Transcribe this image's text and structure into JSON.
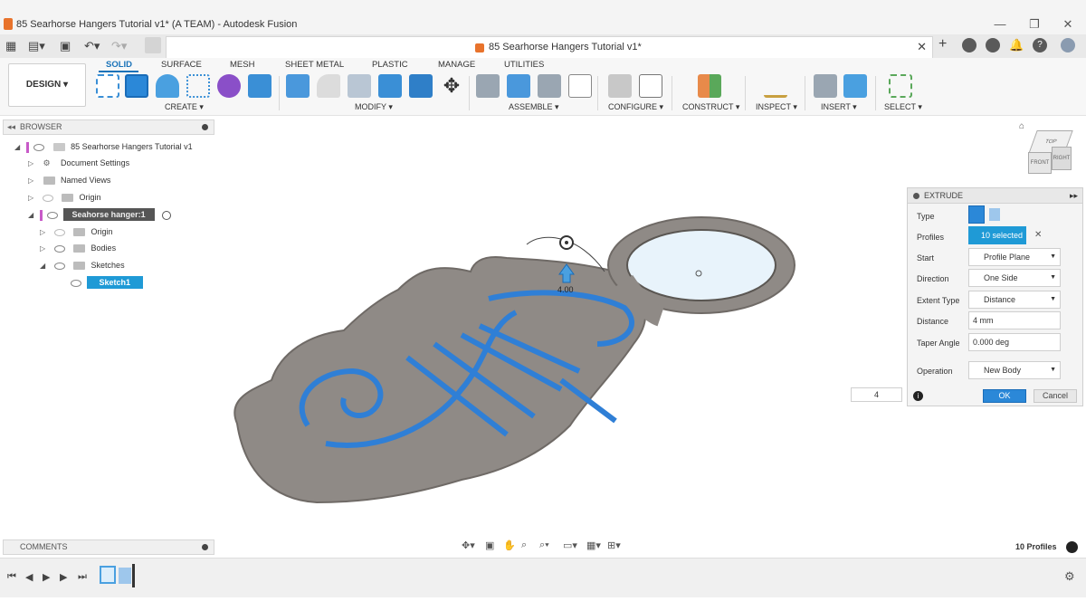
{
  "window": {
    "title": "85 Searhorse Hangers Tutorial v1* (A TEAM) - Autodesk Fusion",
    "minimize": "—",
    "maximize": "❐",
    "close": "✕"
  },
  "document_tab": {
    "title": "85 Searhorse Hangers Tutorial v1*",
    "close": "✕"
  },
  "ribbon": {
    "workspace": "DESIGN ▾",
    "tabs": [
      "SOLID",
      "SURFACE",
      "MESH",
      "SHEET METAL",
      "PLASTIC",
      "MANAGE",
      "UTILITIES"
    ],
    "active_tab": "SOLID",
    "groups": [
      "CREATE ▾",
      "MODIFY ▾",
      "ASSEMBLE ▾",
      "CONFIGURE ▾",
      "CONSTRUCT ▾",
      "INSPECT ▾",
      "INSERT ▾",
      "SELECT ▾"
    ]
  },
  "browser": {
    "title": "BROWSER",
    "items": [
      {
        "label": "85 Searhorse Hangers Tutorial v1"
      },
      {
        "label": "Document Settings"
      },
      {
        "label": "Named Views"
      },
      {
        "label": "Origin"
      },
      {
        "label": "Seahorse hanger:1"
      },
      {
        "label": "Origin"
      },
      {
        "label": "Bodies"
      },
      {
        "label": "Sketches"
      },
      {
        "label": "Sketch1"
      }
    ]
  },
  "comments": {
    "title": "COMMENTS"
  },
  "extrude": {
    "title": "EXTRUDE",
    "rows": {
      "type": "Type",
      "profiles": "Profiles",
      "profiles_value": "10 selected",
      "start": "Start",
      "start_value": "Profile Plane",
      "direction": "Direction",
      "direction_value": "One Side",
      "extent_type": "Extent Type",
      "extent_type_value": "Distance",
      "distance": "Distance",
      "distance_value": "4 mm",
      "taper_angle": "Taper Angle",
      "taper_angle_value": "0.000 deg",
      "operation": "Operation",
      "operation_value": "New Body"
    },
    "ok": "OK",
    "cancel": "Cancel"
  },
  "viewport": {
    "distance_input": "4",
    "manipulator_label": "4.00",
    "viewcube": {
      "top": "TOP",
      "front": "FRONT",
      "right": "RIGHT"
    }
  },
  "status": {
    "profiles": "10 Profiles"
  },
  "colors": {
    "accent": "#1f9ad6",
    "ok_button": "#2b88d8",
    "body": "#8f8a86",
    "sketch_profile": "#2f7fd6"
  }
}
